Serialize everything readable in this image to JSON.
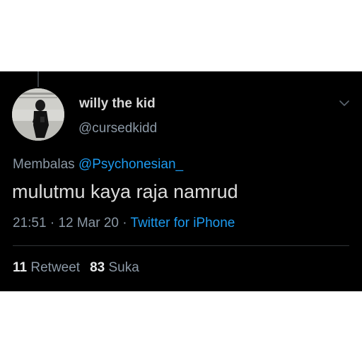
{
  "tweet": {
    "display_name": "willy the kid",
    "handle": "@cursedkidd",
    "reply_prefix": "Membalas",
    "reply_to": "@Psychonesian_",
    "text": "mulutmu kaya raja namrud",
    "time": "21:51",
    "separator": "·",
    "date": "12 Mar 20",
    "source": "Twitter for iPhone",
    "retweet_count": "11",
    "retweet_label": "Retweet",
    "like_count": "83",
    "like_label": "Suka"
  },
  "icons": {
    "menu": "chevron-down-icon",
    "avatar": "profile-photo"
  },
  "colors": {
    "background": "#000000",
    "text": "#d9d9d9",
    "secondary": "#8b98a5",
    "accent": "#1d9bf0",
    "page_background": "#ffffff"
  }
}
